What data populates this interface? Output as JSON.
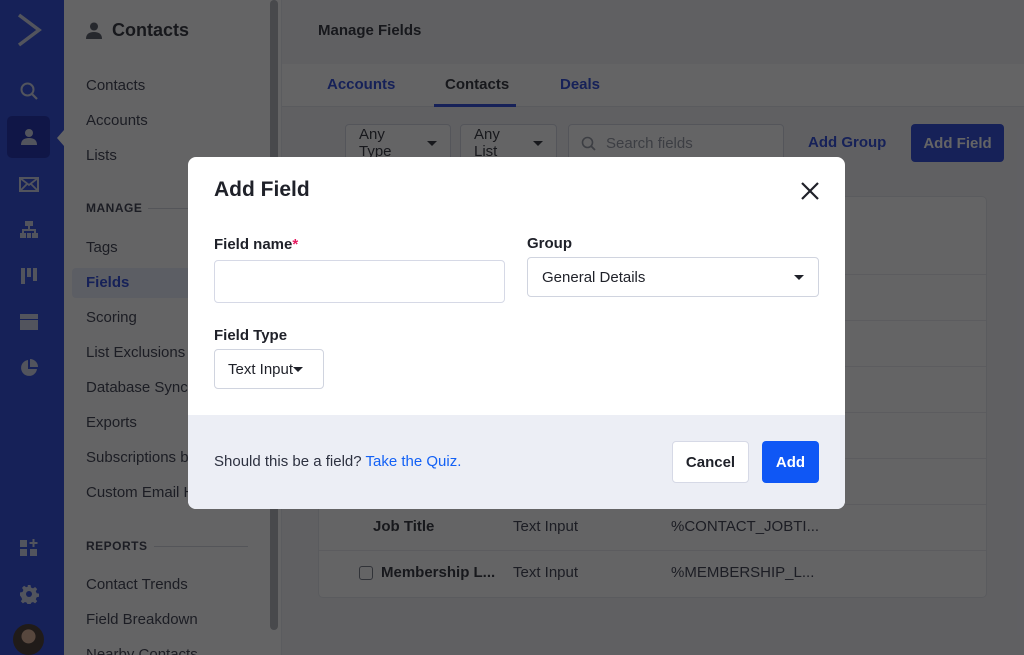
{
  "rail": {
    "items": [
      {
        "icon": "search-icon"
      },
      {
        "icon": "contacts-icon",
        "active": true
      },
      {
        "icon": "mail-icon"
      },
      {
        "icon": "automations-icon"
      },
      {
        "icon": "deals-pipeline-icon"
      },
      {
        "icon": "website-icon"
      },
      {
        "icon": "reports-pie-icon"
      },
      {
        "icon": "apps-add-icon"
      },
      {
        "icon": "gear-icon"
      }
    ],
    "avatar": "user-avatar"
  },
  "subnav": {
    "title": "Contacts",
    "items": [
      "Contacts",
      "Accounts",
      "Lists"
    ],
    "manage_label": "MANAGE",
    "manage_items": [
      "Tags",
      "Fields",
      "Scoring",
      "List Exclusions",
      "Database Sync",
      "Exports",
      "Subscriptions b",
      "Custom Email H"
    ],
    "active_item": "Fields",
    "reports_label": "REPORTS",
    "reports_items": [
      "Contact Trends",
      "Field Breakdown",
      "Nearby Contacts"
    ]
  },
  "main": {
    "title": "Manage Fields",
    "tabs": [
      {
        "label": "Accounts",
        "active": false
      },
      {
        "label": "Contacts",
        "active": true
      },
      {
        "label": "Deals",
        "active": false
      }
    ],
    "filters": {
      "type": "Any Type",
      "list": "Any List",
      "search_placeholder": "Search fields"
    },
    "add_group_label": "Add Group",
    "add_field_label": "Add Field",
    "table_rows": [
      {
        "name": "Job Title",
        "type": "Text Input",
        "tag": "%CONTACT_JOBTI...",
        "checkbox": false
      },
      {
        "name": "Membership L...",
        "type": "Text Input",
        "tag": "%MEMBERSHIP_L...",
        "checkbox": true
      }
    ]
  },
  "modal": {
    "title": "Add Field",
    "field_name_label": "Field name",
    "required_mark": "*",
    "field_name_value": "",
    "group_label": "Group",
    "group_value": "General Details",
    "field_type_label": "Field Type",
    "field_type_value": "Text Input",
    "footer_question": "Should this be a field?",
    "footer_link": "Take the Quiz.",
    "cancel_label": "Cancel",
    "add_label": "Add"
  },
  "colors": {
    "brand_blue": "#1b3bd8",
    "primary_button": "#0f57f5",
    "link": "#1361f5",
    "required": "#e5195e"
  }
}
